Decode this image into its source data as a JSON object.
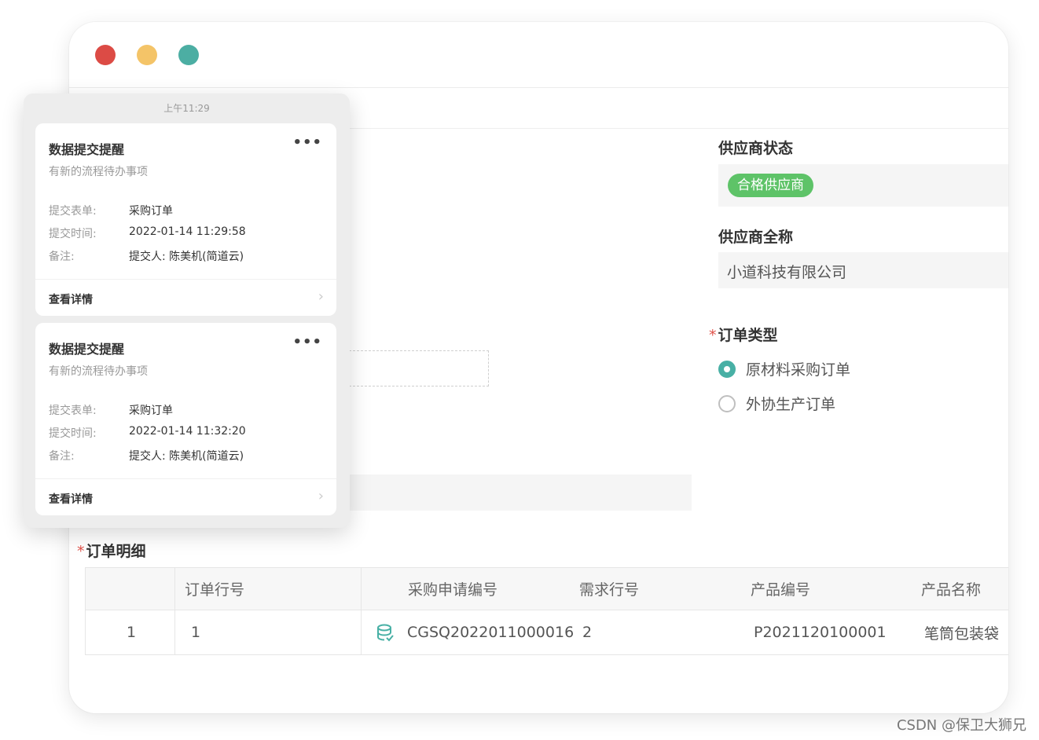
{
  "form": {
    "supplier_status_label": "供应商状态",
    "supplier_status_badge": "合格供应商",
    "supplier_fullname_label": "供应商全称",
    "supplier_fullname_value": "小道科技有限公司",
    "order_type_label": "订单类型",
    "order_type_options": [
      "原材料采购订单",
      "外协生产订单"
    ],
    "order_type_selected": "原材料采购订单",
    "required_mark": "*"
  },
  "table": {
    "title": "订单明细",
    "headers": [
      "订单行号",
      "采购申请编号",
      "需求行号",
      "产品编号",
      "产品名称"
    ],
    "rows": [
      {
        "index": "1",
        "line_no": "1",
        "request_no": "CGSQ2022011000016",
        "demand_line": "2",
        "product_no": "P2021120100001",
        "product_name": "笔筒包装袋"
      }
    ]
  },
  "notifications": {
    "time": "上午11:29",
    "cards": [
      {
        "title": "数据提交提醒",
        "subtitle": "有新的流程待办事项",
        "form_label": "提交表单:",
        "form_value": "采购订单",
        "time_label": "提交时间:",
        "time_value": "2022-01-14 11:29:58",
        "note_label": "备注:",
        "note_value": "提交人: 陈美机(简道云)",
        "link": "查看详情",
        "more": "•••"
      },
      {
        "title": "数据提交提醒",
        "subtitle": "有新的流程待办事项",
        "form_label": "提交表单:",
        "form_value": "采购订单",
        "time_label": "提交时间:",
        "time_value": "2022-01-14 11:32:20",
        "note_label": "备注:",
        "note_value": "提交人: 陈美机(简道云)",
        "link": "查看详情",
        "more": "•••"
      }
    ]
  },
  "colors": {
    "close": "#dc4b45",
    "minimize": "#f4c468",
    "maximize": "#4caea3",
    "badge_green": "#5ec368",
    "radio_teal": "#48b0a5"
  },
  "watermark": "CSDN @保卫大狮兄"
}
